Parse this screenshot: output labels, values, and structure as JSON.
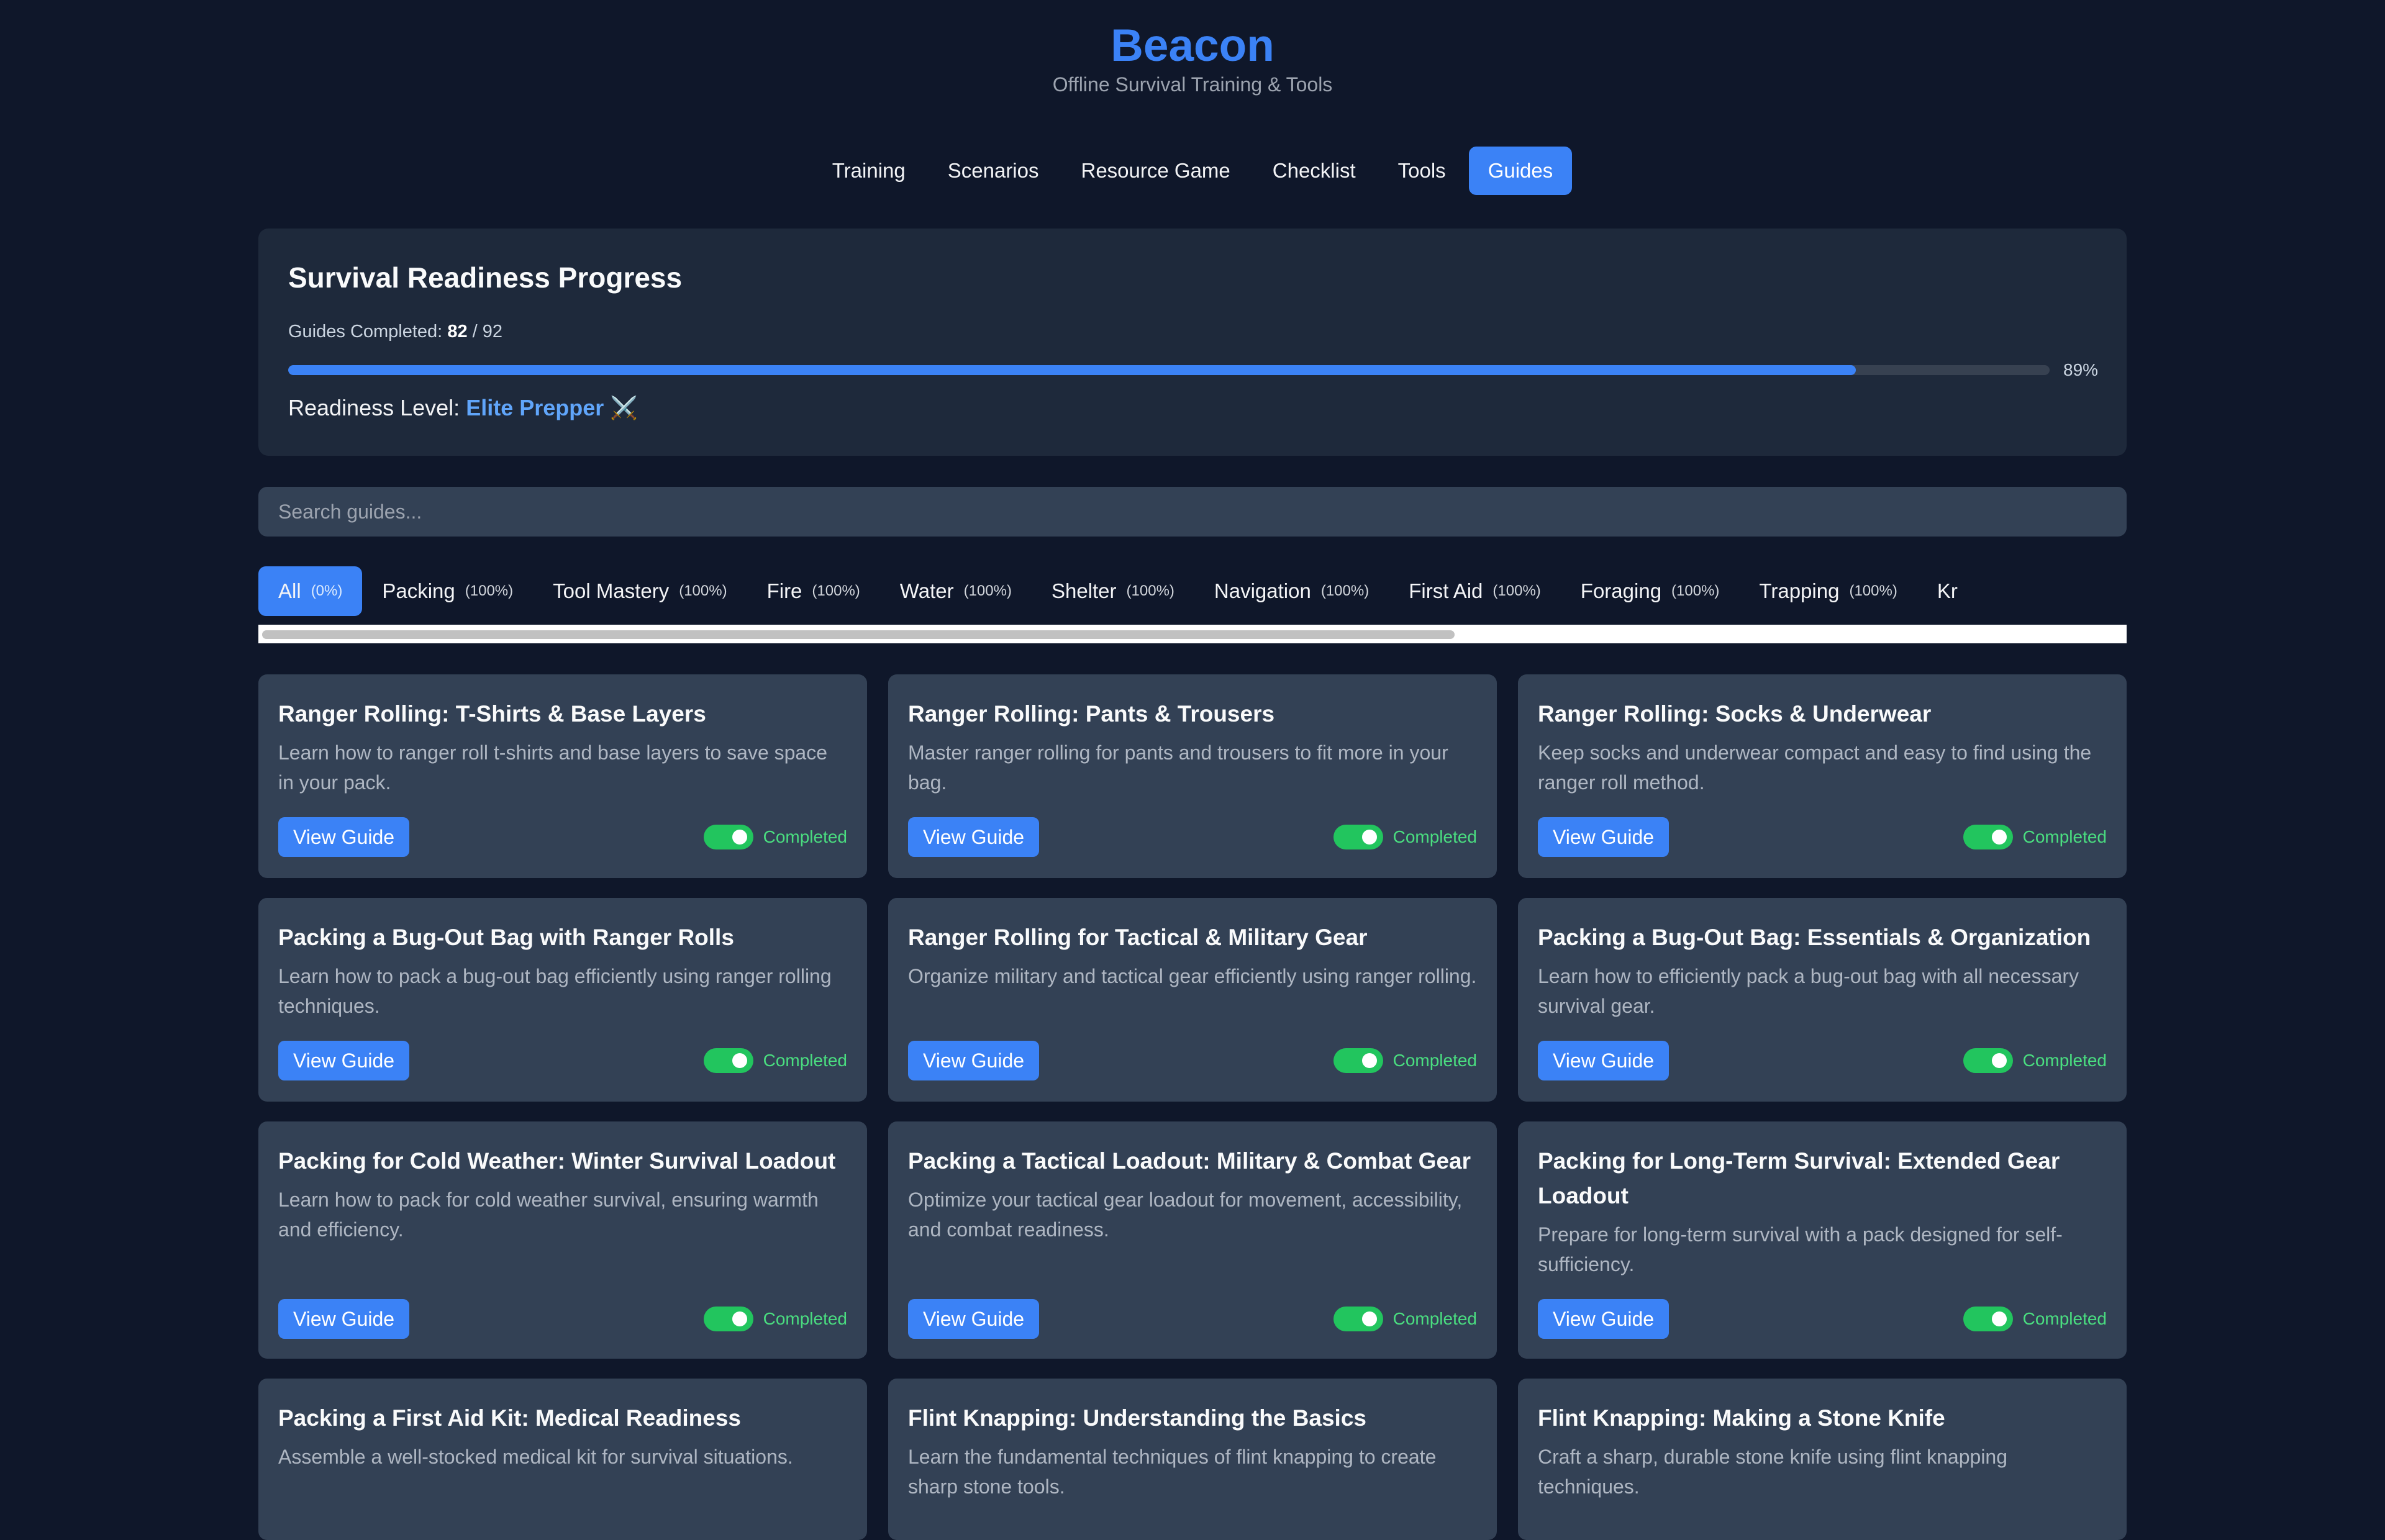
{
  "app": {
    "title": "Beacon",
    "subtitle": "Offline Survival Training & Tools"
  },
  "nav": {
    "items": [
      {
        "label": "Training"
      },
      {
        "label": "Scenarios"
      },
      {
        "label": "Resource Game"
      },
      {
        "label": "Checklist"
      },
      {
        "label": "Tools"
      },
      {
        "label": "Guides",
        "active": true
      }
    ]
  },
  "progress": {
    "title": "Survival Readiness Progress",
    "guides_label": "Guides Completed:",
    "completed": "82",
    "separator": "/",
    "total": "92",
    "percent_text": "89%",
    "fill_fraction": 0.89,
    "readiness_label": "Readiness Level:",
    "readiness_value": "Elite Prepper",
    "readiness_icon": "⚔️",
    "accent_color": "#3b82f6"
  },
  "search": {
    "placeholder": "Search guides..."
  },
  "filters": [
    {
      "label": "All",
      "pct": "(0%)",
      "active": true
    },
    {
      "label": "Packing",
      "pct": "(100%)"
    },
    {
      "label": "Tool Mastery",
      "pct": "(100%)"
    },
    {
      "label": "Fire",
      "pct": "(100%)"
    },
    {
      "label": "Water",
      "pct": "(100%)"
    },
    {
      "label": "Shelter",
      "pct": "(100%)"
    },
    {
      "label": "Navigation",
      "pct": "(100%)"
    },
    {
      "label": "First Aid",
      "pct": "(100%)"
    },
    {
      "label": "Foraging",
      "pct": "(100%)"
    },
    {
      "label": "Trapping",
      "pct": "(100%)"
    },
    {
      "label": "Kr",
      "pct": ""
    }
  ],
  "guides": [
    {
      "title": "Ranger Rolling: T-Shirts & Base Layers",
      "desc": "Learn how to ranger roll t-shirts and base layers to save space in your pack.",
      "button": "View Guide",
      "status": "Completed"
    },
    {
      "title": "Ranger Rolling: Pants & Trousers",
      "desc": "Master ranger rolling for pants and trousers to fit more in your bag.",
      "button": "View Guide",
      "status": "Completed"
    },
    {
      "title": "Ranger Rolling: Socks & Underwear",
      "desc": "Keep socks and underwear compact and easy to find using the ranger roll method.",
      "button": "View Guide",
      "status": "Completed"
    },
    {
      "title": "Packing a Bug-Out Bag with Ranger Rolls",
      "desc": "Learn how to pack a bug-out bag efficiently using ranger rolling techniques.",
      "button": "View Guide",
      "status": "Completed"
    },
    {
      "title": "Ranger Rolling for Tactical & Military Gear",
      "desc": "Organize military and tactical gear efficiently using ranger rolling.",
      "button": "View Guide",
      "status": "Completed"
    },
    {
      "title": "Packing a Bug-Out Bag: Essentials & Organization",
      "desc": "Learn how to efficiently pack a bug-out bag with all necessary survival gear.",
      "button": "View Guide",
      "status": "Completed"
    },
    {
      "title": "Packing for Cold Weather: Winter Survival Loadout",
      "desc": "Learn how to pack for cold weather survival, ensuring warmth and efficiency.",
      "button": "View Guide",
      "status": "Completed"
    },
    {
      "title": "Packing a Tactical Loadout: Military & Combat Gear",
      "desc": "Optimize your tactical gear loadout for movement, accessibility, and combat readiness.",
      "button": "View Guide",
      "status": "Completed"
    },
    {
      "title": "Packing for Long-Term Survival: Extended Gear Loadout",
      "desc": "Prepare for long-term survival with a pack designed for self-sufficiency.",
      "button": "View Guide",
      "status": "Completed"
    },
    {
      "title": "Packing a First Aid Kit: Medical Readiness",
      "desc": "Assemble a well-stocked medical kit for survival situations.",
      "button": "",
      "status": ""
    },
    {
      "title": "Flint Knapping: Understanding the Basics",
      "desc": "Learn the fundamental techniques of flint knapping to create sharp stone tools.",
      "button": "",
      "status": ""
    },
    {
      "title": "Flint Knapping: Making a Stone Knife",
      "desc": "Craft a sharp, durable stone knife using flint knapping techniques.",
      "button": "",
      "status": ""
    }
  ]
}
